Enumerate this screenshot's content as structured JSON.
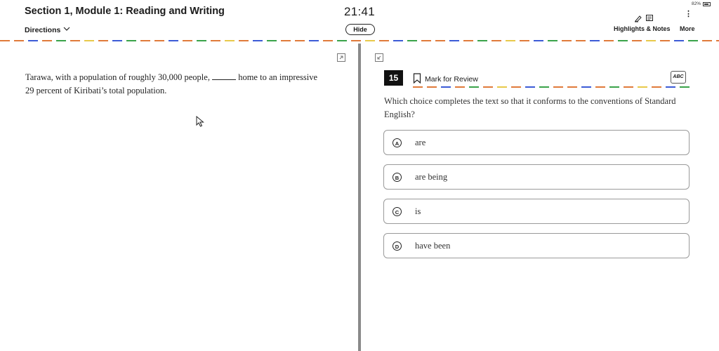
{
  "header": {
    "title": "Section 1, Module 1: Reading and Writing",
    "directions_label": "Directions",
    "timer": "21:41",
    "hide_label": "Hide",
    "battery": "82%",
    "battery_level": 0.82,
    "highlights_label": "Highlights & Notes",
    "more_label": "More"
  },
  "passage": {
    "before": "Tarawa, with a population of roughly 30,000 people, ",
    "after": " home to an impressive 29 percent of Kiribati’s total population."
  },
  "question": {
    "number": "15",
    "mark_label": "Mark for Review",
    "abc_label": "ABC",
    "prompt": "Which choice completes the text so that it conforms to the conventions of Standard English?",
    "choices": [
      {
        "letter": "A",
        "text": "are"
      },
      {
        "letter": "B",
        "text": "are being"
      },
      {
        "letter": "C",
        "text": "is"
      },
      {
        "letter": "D",
        "text": "have been"
      }
    ]
  },
  "colors": {
    "dash_orange": "#e07a3a",
    "dash_blue": "#3c5bd6",
    "dash_green": "#3aa34a",
    "dash_yellow": "#e8c94a",
    "divider": "#8a8a8a"
  },
  "icons": {
    "directions_chevron": "chevron-down-icon",
    "highlight": "pen-icon",
    "notes": "notes-icon",
    "more": "kebab-icon",
    "bookmark": "bookmark-icon",
    "expand": "expand-icon",
    "collapse": "collapse-icon",
    "cursor": "mouse-pointer-icon"
  }
}
